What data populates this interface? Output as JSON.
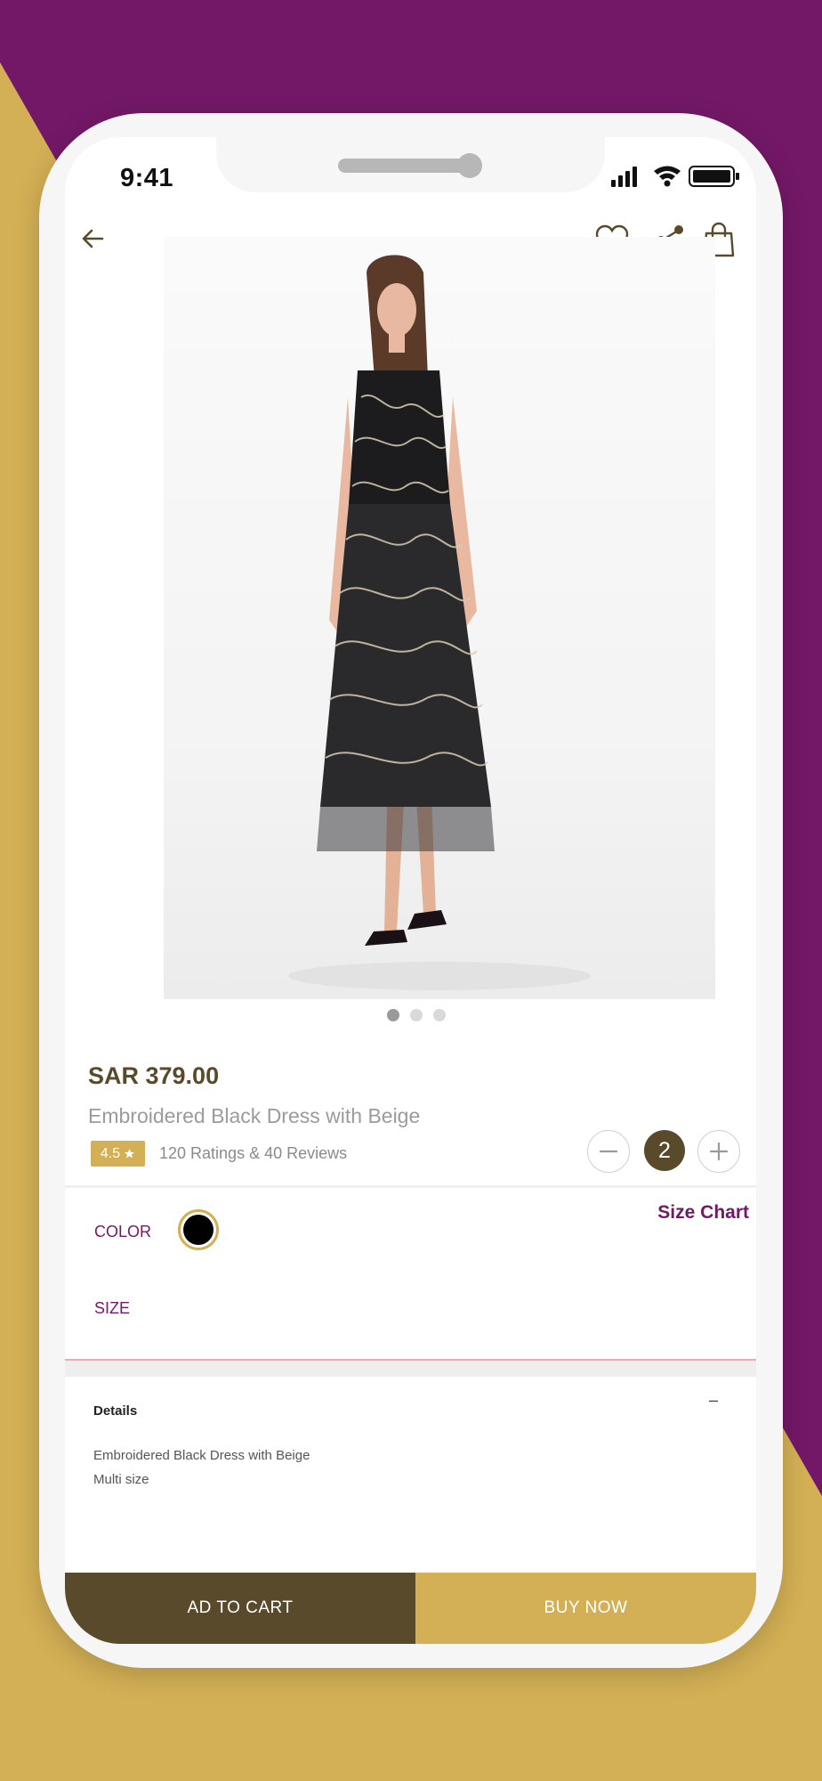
{
  "status_bar": {
    "time": "9:41"
  },
  "nav": {
    "icons": [
      "back-icon",
      "heart-icon",
      "share-icon",
      "shopping-bag-icon"
    ]
  },
  "product": {
    "price": "SAR 379.00",
    "title": "Embroidered Black Dress with Beige",
    "rating": "4.5",
    "rating_icon": "star-icon",
    "reviews_text": "120 Ratings & 40 Reviews",
    "image_count": 3,
    "active_image_index": 0,
    "quantity": "2"
  },
  "options": {
    "color_label": "COLOR",
    "selected_color": "#000000",
    "size_label": "SIZE",
    "size_chart_label": "Size Chart"
  },
  "details": {
    "title": "Details",
    "toggle": "–",
    "lines": [
      "Embroidered Black Dress with Beige",
      "Multi size"
    ]
  },
  "actions": {
    "add_to_cart": "AD TO CART",
    "buy_now": "BUY NOW"
  },
  "colors": {
    "brand_purple": "#731866",
    "brand_gold": "#d3b055",
    "brand_brown": "#5a4a2c"
  }
}
